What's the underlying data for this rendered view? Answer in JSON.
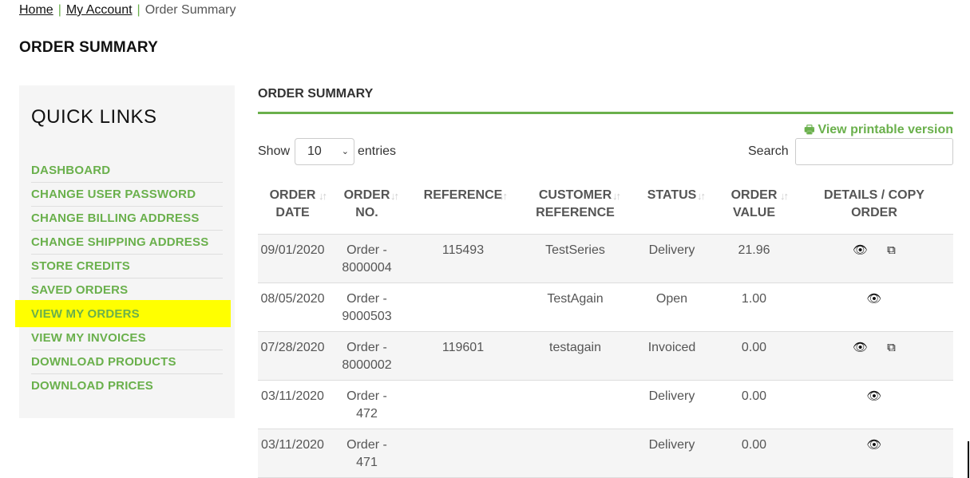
{
  "breadcrumb": {
    "home": "Home",
    "account": "My Account",
    "current": "Order Summary",
    "separator": "|"
  },
  "page_title": "ORDER SUMMARY",
  "sidebar": {
    "title": "QUICK LINKS",
    "items": [
      {
        "label": "DASHBOARD"
      },
      {
        "label": "CHANGE USER PASSWORD"
      },
      {
        "label": "CHANGE BILLING ADDRESS"
      },
      {
        "label": "CHANGE SHIPPING ADDRESS"
      },
      {
        "label": "STORE CREDITS"
      },
      {
        "label": "SAVED ORDERS"
      },
      {
        "label": "VIEW MY ORDERS",
        "active": true
      },
      {
        "label": "VIEW MY INVOICES"
      },
      {
        "label": "DOWNLOAD PRODUCTS"
      },
      {
        "label": "DOWNLOAD PRICES"
      }
    ]
  },
  "main": {
    "section_title": "ORDER SUMMARY",
    "print_link": "View printable version",
    "show_label": "Show",
    "entries_value": "10",
    "entries_label": "entries",
    "search_label": "Search",
    "search_value": ""
  },
  "table": {
    "headers": [
      [
        "ORDER",
        "DATE"
      ],
      [
        "ORDER",
        "NO."
      ],
      [
        "REFERENCE"
      ],
      [
        "CUSTOMER",
        "REFERENCE"
      ],
      [
        "STATUS"
      ],
      [
        "ORDER",
        "VALUE"
      ],
      [
        "DETAILS / COPY",
        "ORDER"
      ]
    ],
    "rows": [
      {
        "date": "09/01/2020",
        "order_no": [
          "Order -",
          "8000004"
        ],
        "reference": "115493",
        "customer_reference": "TestSeries",
        "status": "Delivery",
        "value": "21.96",
        "copy": true
      },
      {
        "date": "08/05/2020",
        "order_no": [
          "Order -",
          "9000503"
        ],
        "reference": "",
        "customer_reference": "TestAgain",
        "status": "Open",
        "value": "1.00",
        "copy": false
      },
      {
        "date": "07/28/2020",
        "order_no": [
          "Order -",
          "8000002"
        ],
        "reference": "119601",
        "customer_reference": "testagain",
        "status": "Invoiced",
        "value": "0.00",
        "copy": true
      },
      {
        "date": "03/11/2020",
        "order_no": [
          "Order -",
          "472"
        ],
        "reference": "",
        "customer_reference": "",
        "status": "Delivery",
        "value": "0.00",
        "copy": false
      },
      {
        "date": "03/11/2020",
        "order_no": [
          "Order -",
          "471"
        ],
        "reference": "",
        "customer_reference": "",
        "status": "Delivery",
        "value": "0.00",
        "copy": false
      }
    ]
  },
  "icons": {
    "view": "eye-icon",
    "copy": "copy-icon",
    "print": "printer-icon",
    "sort": "sort-icon"
  },
  "colors": {
    "accent": "#6ab04c",
    "highlight": "#ffff00"
  }
}
